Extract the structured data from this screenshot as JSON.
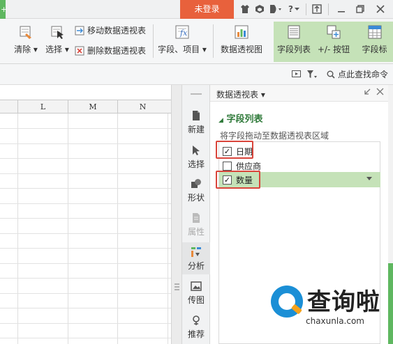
{
  "titlebar": {
    "tab_fragment": "+",
    "login_label": "未登录",
    "icons": [
      "shirt-icon",
      "cube-icon",
      "d-icon",
      "help-icon",
      "export-icon",
      "minimize-icon",
      "restore-icon",
      "close-icon"
    ],
    "help_mark": "?"
  },
  "ribbon": {
    "clear_label": "清除",
    "select_label": "选择",
    "move_pivot_label": "移动数据透视表",
    "delete_pivot_label": "删除数据透视表",
    "fields_items_label": "字段、项目",
    "pivot_chart_label": "数据透视图",
    "field_list_label": "字段列表",
    "plus_minus_label": "+/- 按钮",
    "field_header_label": "字段标",
    "fx_label": "fx"
  },
  "subbar": {
    "find_command_label": "点此查找命令"
  },
  "sheet": {
    "columns": [
      "L",
      "M",
      "N"
    ]
  },
  "sidebar": {
    "items": [
      {
        "label": "新建",
        "icon": "file-icon"
      },
      {
        "label": "选择",
        "icon": "cursor-icon"
      },
      {
        "label": "形状",
        "icon": "shapes-icon"
      },
      {
        "label": "属性",
        "icon": "properties-icon"
      },
      {
        "label": "分析",
        "icon": "analysis-icon"
      },
      {
        "label": "传图",
        "icon": "image-icon"
      },
      {
        "label": "推荐",
        "icon": "recommend-icon"
      }
    ]
  },
  "pivot_panel": {
    "title": "数据透视表",
    "section_title": "字段列表",
    "hint": "将字段拖动至数据透视表区域",
    "fields": [
      {
        "label": "日期",
        "checked": true
      },
      {
        "label": "供应商",
        "checked": false
      },
      {
        "label": "数量",
        "checked": true
      }
    ]
  },
  "watermark": {
    "brand": "查询啦",
    "url": "chaxunla.com"
  },
  "colors": {
    "accent_green": "#5fb760",
    "selected_green": "#c5e2b8",
    "login_orange": "#e8613c",
    "highlight_red": "#d9453b",
    "logo_blue": "#1b8fd6"
  }
}
